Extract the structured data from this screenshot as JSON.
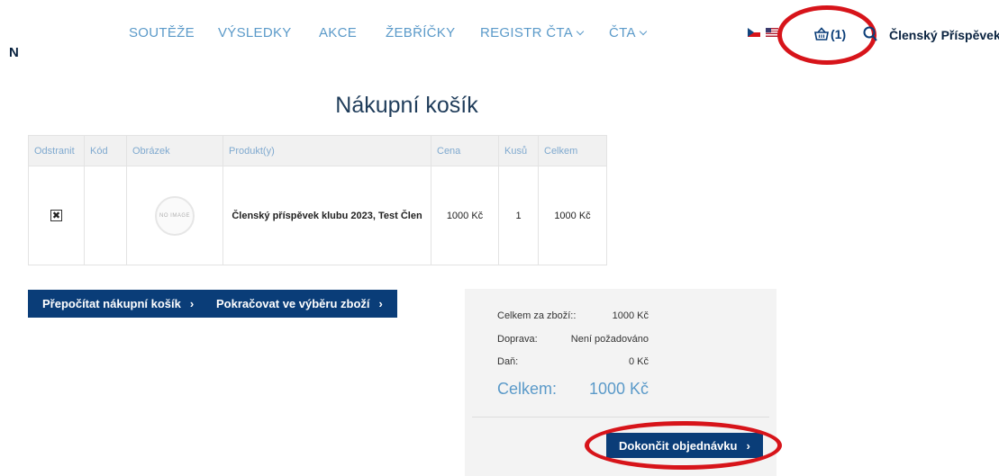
{
  "header": {
    "logo_letter": "N",
    "nav": [
      {
        "label": "SOUTĚŽE",
        "dropdown": false
      },
      {
        "label": "VÝSLEDKY",
        "dropdown": false
      },
      {
        "label": "AKCE",
        "dropdown": false
      },
      {
        "label": "ŽEBŘÍČKY",
        "dropdown": false
      },
      {
        "label": "REGISTR ČTA",
        "dropdown": true
      },
      {
        "label": "ČTA",
        "dropdown": true
      }
    ],
    "cart_count": "(1)",
    "member_link": "Členský Příspěvek"
  },
  "page_title": "Nákupní košík",
  "cart_table": {
    "headers": [
      "Odstranit",
      "Kód",
      "Obrázek",
      "Produkt(y)",
      "Cena",
      "Kusů",
      "Celkem"
    ],
    "rows": [
      {
        "remove": "✖",
        "code": "",
        "image_placeholder": "NO IMAGE",
        "product": "Členský příspěvek klubu 2023, Test Člen",
        "price": "1000 Kč",
        "qty": "1",
        "total": "1000 Kč"
      }
    ]
  },
  "buttons": {
    "recalculate": "Přepočítat nákupní košík",
    "continue": "Pokračovat ve výběru zboží",
    "finish": "Dokončit objednávku",
    "chevron": "›"
  },
  "summary": {
    "subtotal_label": "Celkem za zboží::",
    "subtotal_value": "1000 Kč",
    "shipping_label": "Doprava:",
    "shipping_value": "Není požadováno",
    "tax_label": "Daň:",
    "tax_value": "0 Kč",
    "total_label": "Celkem:",
    "total_value": "1000 Kč"
  },
  "colors": {
    "primary": "#0a3d78",
    "accent": "#5b9ac9",
    "highlight": "#d7141a"
  }
}
